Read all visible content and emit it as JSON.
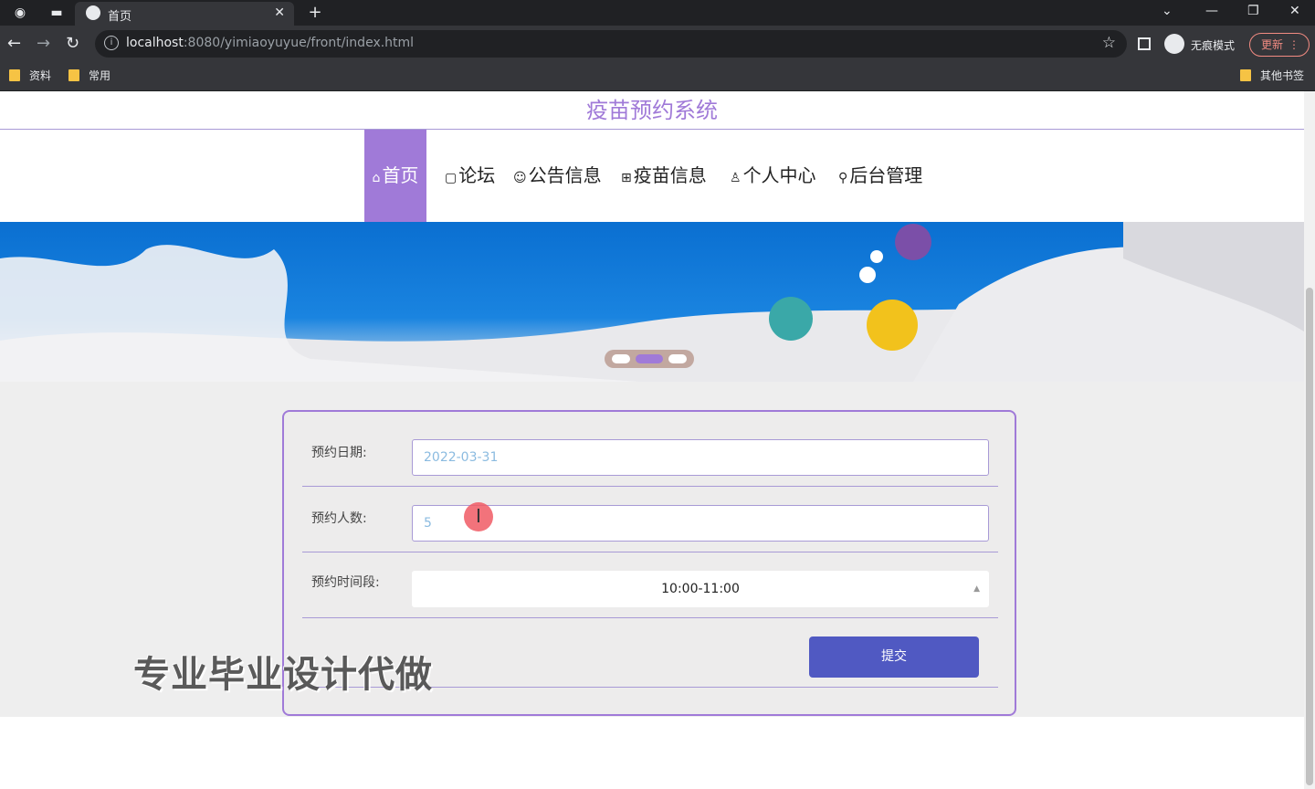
{
  "browser": {
    "tab_title": "首页",
    "url_host": "localhost",
    "url_rest": ":8080/yimiaoyuyue/front/index.html",
    "incognito_label": "无痕模式",
    "update_label": "更新",
    "bookmarks": [
      "资料",
      "常用"
    ],
    "other_bookmarks": "其他书签"
  },
  "site": {
    "title": "疫苗预约系统"
  },
  "nav": {
    "items": [
      {
        "icon": "⌂",
        "label": "首页"
      },
      {
        "icon": "▢",
        "label": "论坛"
      },
      {
        "icon": "☺",
        "label": "公告信息"
      },
      {
        "icon": "⊞",
        "label": "疫苗信息"
      },
      {
        "icon": "♙",
        "label": "个人中心"
      },
      {
        "icon": "⚲",
        "label": "后台管理"
      }
    ]
  },
  "form": {
    "date_label": "预约日期:",
    "date_value": "2022-03-31",
    "count_label": "预约人数:",
    "count_value": "5",
    "slot_label": "预约时间段:",
    "slot_value": "10:00-11:00",
    "submit_label": "提交"
  },
  "watermark": "专业毕业设计代做",
  "colors": {
    "accent": "#a07ad8",
    "submit": "#5059c2"
  }
}
